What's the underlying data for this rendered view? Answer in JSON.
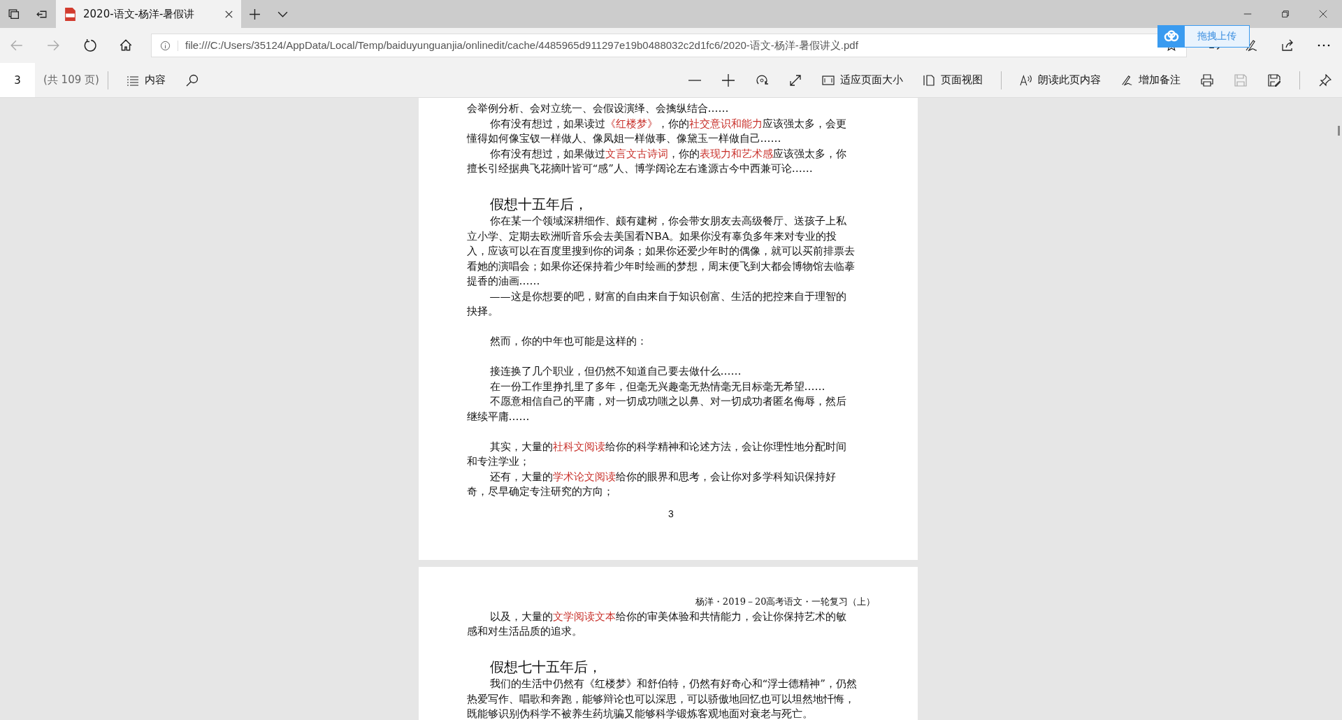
{
  "tab": {
    "title": "2020-语文-杨洋-暑假讲",
    "selected": true
  },
  "address_bar": {
    "url": "file:///C:/Users/35124/AppData/Local/Temp/baiduyunguanjia/onlinedit/cache/4485965d911297e19b0488032c2d1fc6/2020-语文-杨洋-暑假讲义.pdf"
  },
  "upload_widget": {
    "label": "拖拽上传"
  },
  "pdf_toolbar": {
    "page": "3",
    "page_count": "(共 109 页)",
    "contents": "内容",
    "fit_page": "适应页面大小",
    "page_view": "页面视图",
    "read_aloud": "朗读此页内容",
    "add_note": "增加备注",
    "save_disabled": true
  },
  "pages": [
    {
      "lines": [
        {
          "kind": "text",
          "indent": false,
          "spans": [
            {
              "text": "会举例分析、会对立统一、会假设演绎、会擒纵结合……",
              "emphasis": false
            }
          ]
        },
        {
          "kind": "text",
          "indent": true,
          "spans": [
            {
              "text": "你有没有想过，如果读过",
              "emphasis": false
            },
            {
              "text": "《红楼梦》",
              "emphasis": true
            },
            {
              "text": "，你的",
              "emphasis": false
            },
            {
              "text": "社交意识和能力",
              "emphasis": true
            },
            {
              "text": "应该强太多，会更",
              "emphasis": false
            }
          ]
        },
        {
          "kind": "text",
          "indent": false,
          "spans": [
            {
              "text": "懂得如何像宝钗一样做人、像凤姐一样做事、像黛玉一样做自己……",
              "emphasis": false
            }
          ]
        },
        {
          "kind": "text",
          "indent": true,
          "spans": [
            {
              "text": "你有没有想过，如果做过",
              "emphasis": false
            },
            {
              "text": "文言文古诗词",
              "emphasis": true
            },
            {
              "text": "，你的",
              "emphasis": false
            },
            {
              "text": "表现力和艺术感",
              "emphasis": true
            },
            {
              "text": "应该强太多，你",
              "emphasis": false
            }
          ]
        },
        {
          "kind": "text",
          "indent": false,
          "spans": [
            {
              "text": "擅长引经据典飞花摘叶皆可“感”人、博学阔论左右逢源古今中西兼可论……",
              "emphasis": false
            }
          ]
        },
        {
          "kind": "blank"
        },
        {
          "kind": "heading",
          "text": "假想十五年后，"
        },
        {
          "kind": "text",
          "indent": true,
          "spans": [
            {
              "text": "你在某一个领域深耕细作、颇有建树，你会带女朋友去高级餐厅、送孩子上私",
              "emphasis": false
            }
          ]
        },
        {
          "kind": "text",
          "indent": false,
          "spans": [
            {
              "text": "立小学、定期去欧洲听音乐会去美国看NBA。如果你没有辜负多年来对专业的投",
              "emphasis": false
            }
          ]
        },
        {
          "kind": "text",
          "indent": false,
          "spans": [
            {
              "text": "入，应该可以在百度里搜到你的词条；如果你还爱少年时的偶像，就可以买前排票去",
              "emphasis": false
            }
          ]
        },
        {
          "kind": "text",
          "indent": false,
          "spans": [
            {
              "text": "看她的演唱会；如果你还保持着少年时绘画的梦想，周末便飞到大都会博物馆去临摹",
              "emphasis": false
            }
          ]
        },
        {
          "kind": "text",
          "indent": false,
          "spans": [
            {
              "text": "提香的油画……",
              "emphasis": false
            }
          ]
        },
        {
          "kind": "text",
          "indent": true,
          "spans": [
            {
              "text": "——这是你想要的吧，财富的自由来自于知识创富、生活的把控来自于理智的",
              "emphasis": false
            }
          ]
        },
        {
          "kind": "text",
          "indent": false,
          "spans": [
            {
              "text": "抉择。",
              "emphasis": false
            }
          ]
        },
        {
          "kind": "blank"
        },
        {
          "kind": "text",
          "indent": true,
          "spans": [
            {
              "text": "然而，你的中年也可能是这样的：",
              "emphasis": false
            }
          ]
        },
        {
          "kind": "blank"
        },
        {
          "kind": "text",
          "indent": true,
          "spans": [
            {
              "text": "接连换了几个职业，但仍然不知道自己要去做什么……",
              "emphasis": false
            }
          ]
        },
        {
          "kind": "text",
          "indent": true,
          "spans": [
            {
              "text": "在一份工作里挣扎里了多年，但毫无兴趣毫无热情毫无目标毫无希望……",
              "emphasis": false
            }
          ]
        },
        {
          "kind": "text",
          "indent": true,
          "spans": [
            {
              "text": "不愿意相信自己的平庸，对一切成功嗤之以鼻、对一切成功者匿名侮辱，然后",
              "emphasis": false
            }
          ]
        },
        {
          "kind": "text",
          "indent": false,
          "spans": [
            {
              "text": "继续平庸……",
              "emphasis": false
            }
          ]
        },
        {
          "kind": "blank"
        },
        {
          "kind": "text",
          "indent": true,
          "spans": [
            {
              "text": "其实，大量的",
              "emphasis": false
            },
            {
              "text": "社科文阅读",
              "emphasis": true
            },
            {
              "text": "给你的科学精神和论述方法，会让你理性地分配时间",
              "emphasis": false
            }
          ]
        },
        {
          "kind": "text",
          "indent": false,
          "spans": [
            {
              "text": "和专注学业；",
              "emphasis": false
            }
          ]
        },
        {
          "kind": "text",
          "indent": true,
          "spans": [
            {
              "text": "还有，大量的",
              "emphasis": false
            },
            {
              "text": "学术论文阅读",
              "emphasis": true
            },
            {
              "text": "给你的眼界和思考，会让你对多学科知识保持好",
              "emphasis": false
            }
          ]
        },
        {
          "kind": "text",
          "indent": false,
          "spans": [
            {
              "text": "奇，尽早确定专注研究的方向；",
              "emphasis": false
            }
          ]
        },
        {
          "kind": "page_number",
          "text": "3"
        }
      ]
    },
    {
      "lines": [
        {
          "kind": "header",
          "text": "杨洋・2019－20高考语文・一轮复习（上）"
        },
        {
          "kind": "text",
          "indent": true,
          "spans": [
            {
              "text": "以及，大量的",
              "emphasis": false
            },
            {
              "text": "文学阅读文本",
              "emphasis": true
            },
            {
              "text": "给你的审美体验和共情能力，会让你保持艺术的敏",
              "emphasis": false
            }
          ]
        },
        {
          "kind": "text",
          "indent": false,
          "spans": [
            {
              "text": "感和对生活品质的追求。",
              "emphasis": false
            }
          ]
        },
        {
          "kind": "blank"
        },
        {
          "kind": "heading",
          "text": "假想七十五年后，"
        },
        {
          "kind": "text",
          "indent": true,
          "spans": [
            {
              "text": "我们的生活中仍然有《红楼梦》和舒伯特，仍然有好奇心和“浮士德精神”，仍然",
              "emphasis": false
            }
          ]
        },
        {
          "kind": "text",
          "indent": false,
          "spans": [
            {
              "text": "热爱写作、唱歌和奔跑，能够辩论也可以深思，可以骄傲地回忆也可以坦然地忏悔，",
              "emphasis": false
            }
          ]
        },
        {
          "kind": "text",
          "indent": false,
          "spans": [
            {
              "text": "既能够识别伪科学不被养生药坑骗又能够科学锻炼客观地面对衰老与死亡。",
              "emphasis": false
            }
          ]
        }
      ]
    }
  ]
}
